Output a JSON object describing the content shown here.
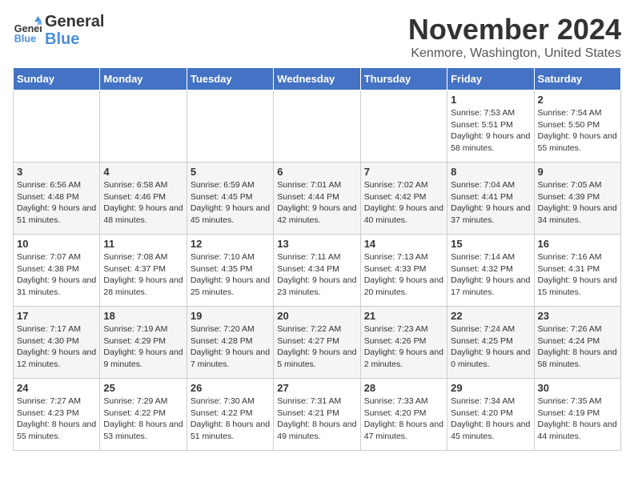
{
  "logo": {
    "line1": "General",
    "line2": "Blue"
  },
  "header": {
    "month": "November 2024",
    "location": "Kenmore, Washington, United States"
  },
  "columns": [
    "Sunday",
    "Monday",
    "Tuesday",
    "Wednesday",
    "Thursday",
    "Friday",
    "Saturday"
  ],
  "weeks": [
    [
      {
        "day": "",
        "text": ""
      },
      {
        "day": "",
        "text": ""
      },
      {
        "day": "",
        "text": ""
      },
      {
        "day": "",
        "text": ""
      },
      {
        "day": "",
        "text": ""
      },
      {
        "day": "1",
        "text": "Sunrise: 7:53 AM\nSunset: 5:51 PM\nDaylight: 9 hours and 58 minutes."
      },
      {
        "day": "2",
        "text": "Sunrise: 7:54 AM\nSunset: 5:50 PM\nDaylight: 9 hours and 55 minutes."
      }
    ],
    [
      {
        "day": "3",
        "text": "Sunrise: 6:56 AM\nSunset: 4:48 PM\nDaylight: 9 hours and 51 minutes."
      },
      {
        "day": "4",
        "text": "Sunrise: 6:58 AM\nSunset: 4:46 PM\nDaylight: 9 hours and 48 minutes."
      },
      {
        "day": "5",
        "text": "Sunrise: 6:59 AM\nSunset: 4:45 PM\nDaylight: 9 hours and 45 minutes."
      },
      {
        "day": "6",
        "text": "Sunrise: 7:01 AM\nSunset: 4:44 PM\nDaylight: 9 hours and 42 minutes."
      },
      {
        "day": "7",
        "text": "Sunrise: 7:02 AM\nSunset: 4:42 PM\nDaylight: 9 hours and 40 minutes."
      },
      {
        "day": "8",
        "text": "Sunrise: 7:04 AM\nSunset: 4:41 PM\nDaylight: 9 hours and 37 minutes."
      },
      {
        "day": "9",
        "text": "Sunrise: 7:05 AM\nSunset: 4:39 PM\nDaylight: 9 hours and 34 minutes."
      }
    ],
    [
      {
        "day": "10",
        "text": "Sunrise: 7:07 AM\nSunset: 4:38 PM\nDaylight: 9 hours and 31 minutes."
      },
      {
        "day": "11",
        "text": "Sunrise: 7:08 AM\nSunset: 4:37 PM\nDaylight: 9 hours and 28 minutes."
      },
      {
        "day": "12",
        "text": "Sunrise: 7:10 AM\nSunset: 4:35 PM\nDaylight: 9 hours and 25 minutes."
      },
      {
        "day": "13",
        "text": "Sunrise: 7:11 AM\nSunset: 4:34 PM\nDaylight: 9 hours and 23 minutes."
      },
      {
        "day": "14",
        "text": "Sunrise: 7:13 AM\nSunset: 4:33 PM\nDaylight: 9 hours and 20 minutes."
      },
      {
        "day": "15",
        "text": "Sunrise: 7:14 AM\nSunset: 4:32 PM\nDaylight: 9 hours and 17 minutes."
      },
      {
        "day": "16",
        "text": "Sunrise: 7:16 AM\nSunset: 4:31 PM\nDaylight: 9 hours and 15 minutes."
      }
    ],
    [
      {
        "day": "17",
        "text": "Sunrise: 7:17 AM\nSunset: 4:30 PM\nDaylight: 9 hours and 12 minutes."
      },
      {
        "day": "18",
        "text": "Sunrise: 7:19 AM\nSunset: 4:29 PM\nDaylight: 9 hours and 9 minutes."
      },
      {
        "day": "19",
        "text": "Sunrise: 7:20 AM\nSunset: 4:28 PM\nDaylight: 9 hours and 7 minutes."
      },
      {
        "day": "20",
        "text": "Sunrise: 7:22 AM\nSunset: 4:27 PM\nDaylight: 9 hours and 5 minutes."
      },
      {
        "day": "21",
        "text": "Sunrise: 7:23 AM\nSunset: 4:26 PM\nDaylight: 9 hours and 2 minutes."
      },
      {
        "day": "22",
        "text": "Sunrise: 7:24 AM\nSunset: 4:25 PM\nDaylight: 9 hours and 0 minutes."
      },
      {
        "day": "23",
        "text": "Sunrise: 7:26 AM\nSunset: 4:24 PM\nDaylight: 8 hours and 58 minutes."
      }
    ],
    [
      {
        "day": "24",
        "text": "Sunrise: 7:27 AM\nSunset: 4:23 PM\nDaylight: 8 hours and 55 minutes."
      },
      {
        "day": "25",
        "text": "Sunrise: 7:29 AM\nSunset: 4:22 PM\nDaylight: 8 hours and 53 minutes."
      },
      {
        "day": "26",
        "text": "Sunrise: 7:30 AM\nSunset: 4:22 PM\nDaylight: 8 hours and 51 minutes."
      },
      {
        "day": "27",
        "text": "Sunrise: 7:31 AM\nSunset: 4:21 PM\nDaylight: 8 hours and 49 minutes."
      },
      {
        "day": "28",
        "text": "Sunrise: 7:33 AM\nSunset: 4:20 PM\nDaylight: 8 hours and 47 minutes."
      },
      {
        "day": "29",
        "text": "Sunrise: 7:34 AM\nSunset: 4:20 PM\nDaylight: 8 hours and 45 minutes."
      },
      {
        "day": "30",
        "text": "Sunrise: 7:35 AM\nSunset: 4:19 PM\nDaylight: 8 hours and 44 minutes."
      }
    ]
  ]
}
